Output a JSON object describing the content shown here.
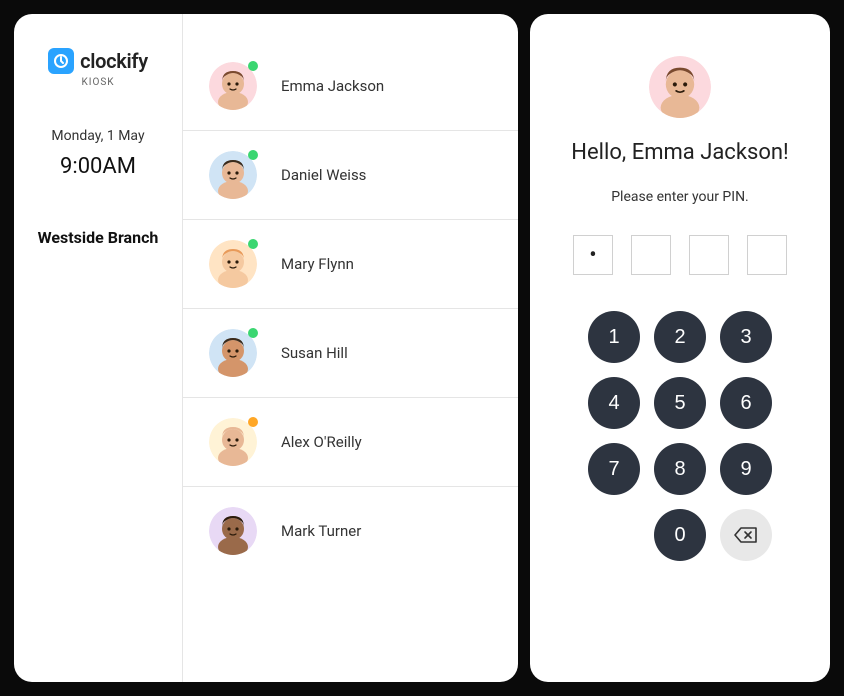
{
  "brand": {
    "name": "clockify",
    "sub": "KIOSK"
  },
  "sidebar": {
    "date": "Monday, 1 May",
    "time": "9:00AM",
    "branch": "Westside Branch"
  },
  "users": [
    {
      "name": "Emma Jackson",
      "status": "green",
      "avatar_bg": "#fcd9de",
      "skin": "#e8b896",
      "hair": "#7a4a2e"
    },
    {
      "name": "Daniel Weiss",
      "status": "green",
      "avatar_bg": "#d0e4f5",
      "skin": "#e8b896",
      "hair": "#3a2a1a"
    },
    {
      "name": "Mary Flynn",
      "status": "green",
      "avatar_bg": "#ffe4c4",
      "skin": "#f5c9a0",
      "hair": "#e89a5a"
    },
    {
      "name": "Susan Hill",
      "status": "green",
      "avatar_bg": "#d0e4f5",
      "skin": "#d4956a",
      "hair": "#3a2a1a"
    },
    {
      "name": "Alex O'Reilly",
      "status": "orange",
      "avatar_bg": "#fff3d6",
      "skin": "#e8b896",
      "hair": "#e8b896"
    },
    {
      "name": "Mark Turner",
      "status": "none",
      "avatar_bg": "#e8d9f5",
      "skin": "#9a6a4a",
      "hair": "#2a1a0a"
    }
  ],
  "pin_panel": {
    "greeting_prefix": "Hello, ",
    "greeting_name": "Emma Jackson",
    "greeting_suffix": "!",
    "prompt": "Please enter your PIN.",
    "entered_count": 1,
    "total_boxes": 4,
    "avatar_bg": "#fcd9de",
    "skin": "#e8b896",
    "hair": "#7a4a2e"
  },
  "keypad": {
    "keys": [
      "1",
      "2",
      "3",
      "4",
      "5",
      "6",
      "7",
      "8",
      "9",
      "",
      "0",
      "back"
    ]
  }
}
